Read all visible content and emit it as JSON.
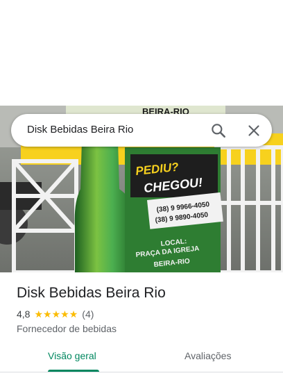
{
  "search": {
    "query": "Disk Bebidas Beira Rio"
  },
  "photo": {
    "banner_top": "BEIRA-RIO",
    "headline_1": "PEDIU?",
    "headline_2": "CHEGOU!",
    "phone_1": "(38) 9 9966-4050",
    "phone_2": "(38) 9 9890-4050",
    "location_1": "LOCAL:",
    "location_2": "PRAÇA DA IGREJA",
    "location_3": "BEIRA-RIO"
  },
  "place": {
    "title": "Disk Bebidas Beira Rio",
    "rating": "4,8",
    "stars": 5,
    "review_count": "(4)",
    "category": "Fornecedor de bebidas"
  },
  "tabs": {
    "overview": "Visão geral",
    "reviews": "Avaliações"
  },
  "colors": {
    "accent": "#01875f",
    "star": "#fbbc04",
    "banner_green": "#2e7d32",
    "banner_yellow": "#f7d11e"
  }
}
